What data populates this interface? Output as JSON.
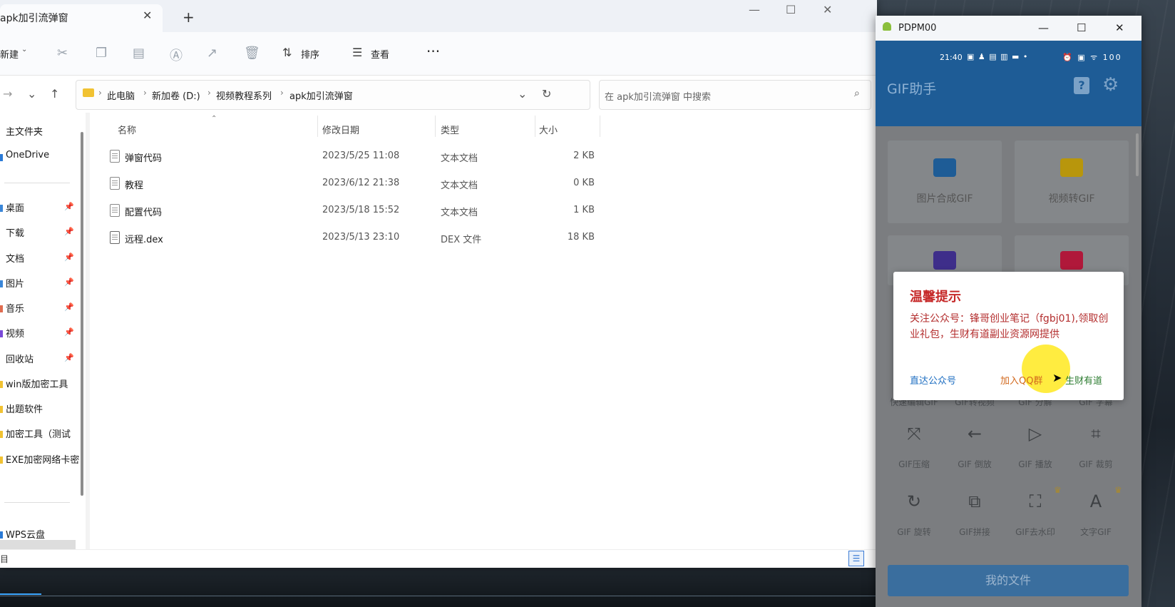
{
  "explorer": {
    "tab_title": "apk加引流弹窗",
    "tab_close": "✕",
    "new_tab": "+",
    "window_buttons": [
      "—",
      "☐",
      "✕"
    ],
    "toolbar": {
      "new_label": "新建",
      "sort_label": "排序",
      "view_label": "查看",
      "more_label": "···"
    },
    "breadcrumb": [
      "此电脑",
      "新加卷 (D:)",
      "视频教程系列",
      "apk加引流弹窗"
    ],
    "search_placeholder": "在 apk加引流弹窗 中搜索",
    "sidebar": {
      "home": "主文件夹",
      "onedrive": "OneDrive",
      "pinned": [
        "桌面",
        "下载",
        "文档",
        "图片",
        "音乐",
        "视频",
        "回收站"
      ],
      "folders": [
        "win版加密工具",
        "出题软件",
        "加密工具（测试",
        "EXE加密网络卡密"
      ],
      "wps": "WPS云盘"
    },
    "columns": [
      "名称",
      "修改日期",
      "类型",
      "大小"
    ],
    "files": [
      {
        "name": "弹窗代码",
        "date": "2023/5/25 11:08",
        "type": "文本文档",
        "size": "2 KB"
      },
      {
        "name": "教程",
        "date": "2023/6/12 21:38",
        "type": "文本文档",
        "size": "0 KB"
      },
      {
        "name": "配置代码",
        "date": "2023/5/18 15:52",
        "type": "文本文档",
        "size": "1 KB"
      },
      {
        "name": "远程.dex",
        "date": "2023/5/13 23:10",
        "type": "DEX 文件",
        "size": "18 KB"
      }
    ],
    "status_text": "目"
  },
  "phone": {
    "window_title": "PDPM00",
    "window_buttons": [
      "—",
      "☐",
      "✕"
    ],
    "status_time": "21:40",
    "status_icons": "▣ ♟ ▤ ▥ ▬ •",
    "status_right": "⏰ ▣ ᯤ 100",
    "app_title": "GIF助手",
    "cards": [
      {
        "label": "图片合成GIF",
        "color": "#1e5c96"
      },
      {
        "label": "视频转GIF",
        "color": "#b8960c"
      },
      {
        "label": "",
        "color": "#3e2e8a"
      },
      {
        "label": "",
        "color": "#b0183a"
      }
    ],
    "row_labels": [
      "快速编辑GIF",
      "GIF转视频",
      "GIF 分解",
      "GIF 字幕"
    ],
    "grid": [
      {
        "icon": "⤧",
        "label": "GIF压缩"
      },
      {
        "icon": "←",
        "label": "GIF 倒放"
      },
      {
        "icon": "▷",
        "label": "GIF 播放"
      },
      {
        "icon": "⌗",
        "label": "GIF 裁剪"
      },
      {
        "icon": "↻",
        "label": "GIF 旋转"
      },
      {
        "icon": "⧉",
        "label": "GIF拼接"
      },
      {
        "icon": "⛶",
        "label": "GIF去水印"
      },
      {
        "icon": "A",
        "label": "文字GIF"
      }
    ],
    "my_files": "我的文件"
  },
  "dialog": {
    "title": "温馨提示",
    "message": "关注公众号：锋哥创业笔记（fgbj01),领取创业礼包，生财有道副业资源网提供",
    "btn_official": "直达公众号",
    "btn_qq": "加入QQ群",
    "btn_scyd": "生财有道"
  },
  "video_progress": 0.035
}
